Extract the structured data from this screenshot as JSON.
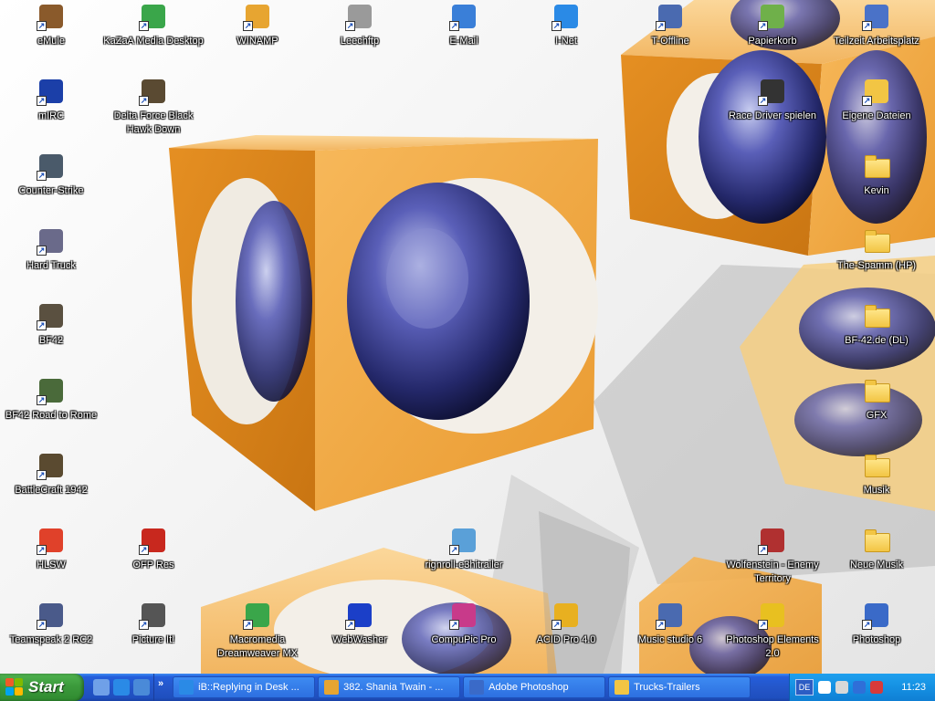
{
  "desktop": {
    "icons": [
      {
        "label": "eMule",
        "icon": "emule-icon",
        "color": "#8a5a2b"
      },
      {
        "label": "KaZaA Media Desktop",
        "icon": "kazaa-icon",
        "color": "#3aa64a"
      },
      {
        "label": "WINAMP",
        "icon": "winamp-icon",
        "color": "#e7a531"
      },
      {
        "label": "Leechftp",
        "icon": "leechftp-icon",
        "color": "#9a9a9a"
      },
      {
        "label": "E-Mail",
        "icon": "email-icon",
        "color": "#3a7fd8"
      },
      {
        "label": "I-Net",
        "icon": "internet-explorer-icon",
        "color": "#2a8ae6"
      },
      {
        "label": "T-Offline",
        "icon": "t-offline-icon",
        "color": "#4a6ab0"
      },
      {
        "label": "Papierkorb",
        "icon": "recycle-bin-icon",
        "color": "#6fb04a"
      },
      {
        "label": "Teilzeit Arbeitsplatz",
        "icon": "my-computer-icon",
        "color": "#4a72c8"
      },
      {
        "label": "mIRC",
        "icon": "mirc-icon",
        "color": "#1b3fa8"
      },
      {
        "label": "Delta Force Black Hawk Down",
        "icon": "delta-force-icon",
        "color": "#5a4a32"
      },
      {
        "label": "Race Driver spielen",
        "icon": "race-driver-icon",
        "color": "#333333"
      },
      {
        "label": "Eigene Dateien",
        "icon": "my-documents-icon",
        "color": "#f2c544"
      },
      {
        "label": "Counter-Strike",
        "icon": "counter-strike-icon",
        "color": "#4a5a6a"
      },
      {
        "label": "Kevin",
        "icon": "folder-icon",
        "color": "#f2c544"
      },
      {
        "label": "Hard Truck",
        "icon": "hard-truck-icon",
        "color": "#6a6a8a"
      },
      {
        "label": "The-Spamm (HP)",
        "icon": "folder-icon",
        "color": "#f2c544"
      },
      {
        "label": "BF42",
        "icon": "bf42-icon",
        "color": "#5a5040"
      },
      {
        "label": "BF-42.de (DL)",
        "icon": "folder-icon",
        "color": "#f2c544"
      },
      {
        "label": "BF42 Road to Rome",
        "icon": "bf42-road-to-rome-icon",
        "color": "#4a6a3a"
      },
      {
        "label": "GFX",
        "icon": "folder-icon",
        "color": "#f2c544"
      },
      {
        "label": "BattleCraft 1942",
        "icon": "battlecraft-icon",
        "color": "#5a4a30"
      },
      {
        "label": "Musik",
        "icon": "folder-icon",
        "color": "#f2c544"
      },
      {
        "label": "HLSW",
        "icon": "hlsw-icon",
        "color": "#e0412a"
      },
      {
        "label": "OFP Res",
        "icon": "ofp-res-icon",
        "color": "#c8281e"
      },
      {
        "label": "rignroll-e3hitrailer",
        "icon": "video-file-icon",
        "color": "#5aa0d8"
      },
      {
        "label": "Wolfenstein - Enemy Territory",
        "icon": "wolfenstein-icon",
        "color": "#b03030"
      },
      {
        "label": "Neue Musik",
        "icon": "folder-icon",
        "color": "#f2c544"
      },
      {
        "label": "Teamspeak 2 RC2",
        "icon": "teamspeak-icon",
        "color": "#4a5a8a"
      },
      {
        "label": "Picture It!",
        "icon": "picture-it-icon",
        "color": "#555555"
      },
      {
        "label": "Macromedia Dreamweaver MX",
        "icon": "dreamweaver-icon",
        "color": "#3aa64a"
      },
      {
        "label": "WebWasher",
        "icon": "webwasher-icon",
        "color": "#1b3fc8"
      },
      {
        "label": "CompuPic Pro",
        "icon": "compupic-icon",
        "color": "#c83a8a"
      },
      {
        "label": "ACID Pro 4.0",
        "icon": "acid-pro-icon",
        "color": "#e8b020"
      },
      {
        "label": "Music studio 6",
        "icon": "music-studio-icon",
        "color": "#4a6ab0"
      },
      {
        "label": "Photoshop Elements 2.0",
        "icon": "photoshop-elements-icon",
        "color": "#e8c020"
      },
      {
        "label": "Photoshop",
        "icon": "photoshop-icon",
        "color": "#3a6ac8"
      }
    ]
  },
  "taskbar": {
    "start_label": "Start",
    "quick_launch": [
      {
        "icon": "show-desktop-icon",
        "color": "#6fa0e8"
      },
      {
        "icon": "internet-explorer-icon",
        "color": "#2a8ae6"
      },
      {
        "icon": "outlook-express-icon",
        "color": "#4a8ad8"
      }
    ],
    "quick_launch_more": "»",
    "tasks": [
      {
        "label": "iB::Replying in Desk ...",
        "icon": "browser-window-icon",
        "color": "#2a8ae6"
      },
      {
        "label": "382. Shania Twain - ...",
        "icon": "winamp-icon",
        "color": "#e7a531"
      },
      {
        "label": "Adobe Photoshop",
        "icon": "photoshop-icon",
        "color": "#3a6ac8"
      },
      {
        "label": "Trucks-Trailers",
        "icon": "folder-icon",
        "color": "#f2c544"
      }
    ],
    "tray": {
      "language": "DE",
      "icons": [
        "help-icon",
        "volume-icon",
        "network-icon",
        "tray-app-icon"
      ],
      "clock": "11:23"
    }
  }
}
